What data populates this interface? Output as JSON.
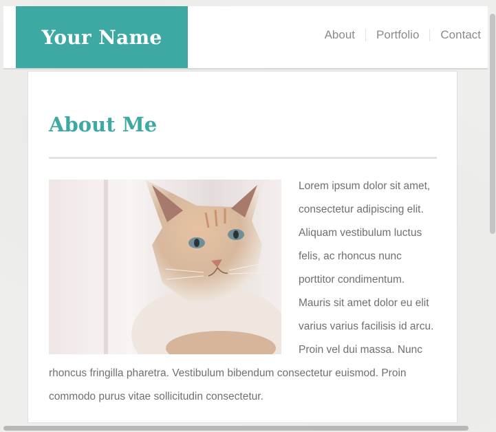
{
  "header": {
    "logo_text": "Your Name",
    "nav": [
      "About",
      "Portfolio",
      "Contact"
    ]
  },
  "main": {
    "heading": "About Me",
    "paragraph": "Lorem ipsum dolor sit amet, consectetur adipiscing elit. Aliquam vestibulum luctus felis, ac rhoncus nunc porttitor condimentum. Mauris sit amet dolor eu elit varius varius facilisis id arcu. Proin vel dui massa. Nunc rhoncus fringilla pharetra. Vestibulum bibendum consectetur euismod. Proin commodo purus vitae sollicitudin consectetur."
  },
  "colors": {
    "accent": "#3da9a2",
    "text": "#6f6f6f",
    "nav_text": "#8a8a8a"
  }
}
